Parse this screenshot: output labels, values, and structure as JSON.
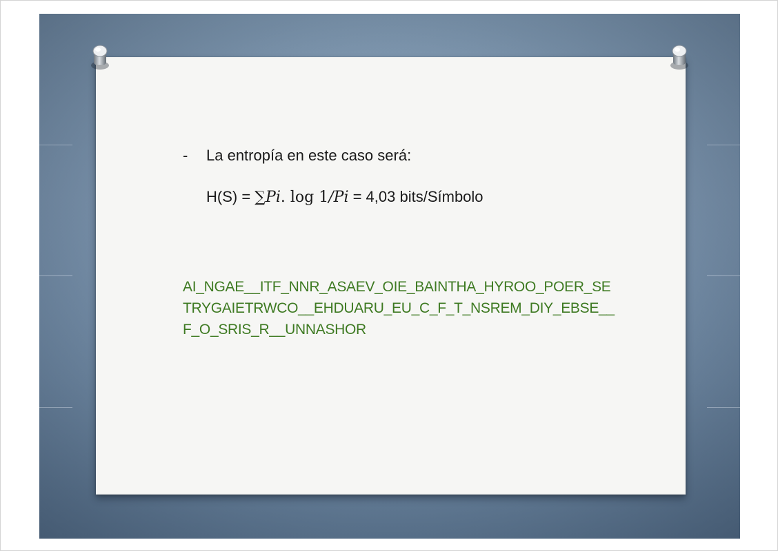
{
  "slide": {
    "bullet": {
      "marker": "-",
      "text": "La entropía en este caso será:"
    },
    "formula": {
      "prefix": "H(S) = ",
      "sum_symbol": "∑",
      "pi": "Pi",
      "dot": ".",
      "log": " log ",
      "one": "1",
      "slash": "/",
      "pi2": "Pi",
      "suffix": " = 4,03 bits/Símbolo"
    },
    "sequence": {
      "line1": "AI_NGAE__ITF_NNR_ASAEV_OIE_BAINTHA_HYROO_POER_SE",
      "line2": "TRYGAIETRWCO__EHDUARU_EU_C_F_T_NSREM_DIY_EBSE__",
      "line3": "F_O_SRIS_R__UNNASHOR",
      "color": "#3e7a22"
    }
  }
}
